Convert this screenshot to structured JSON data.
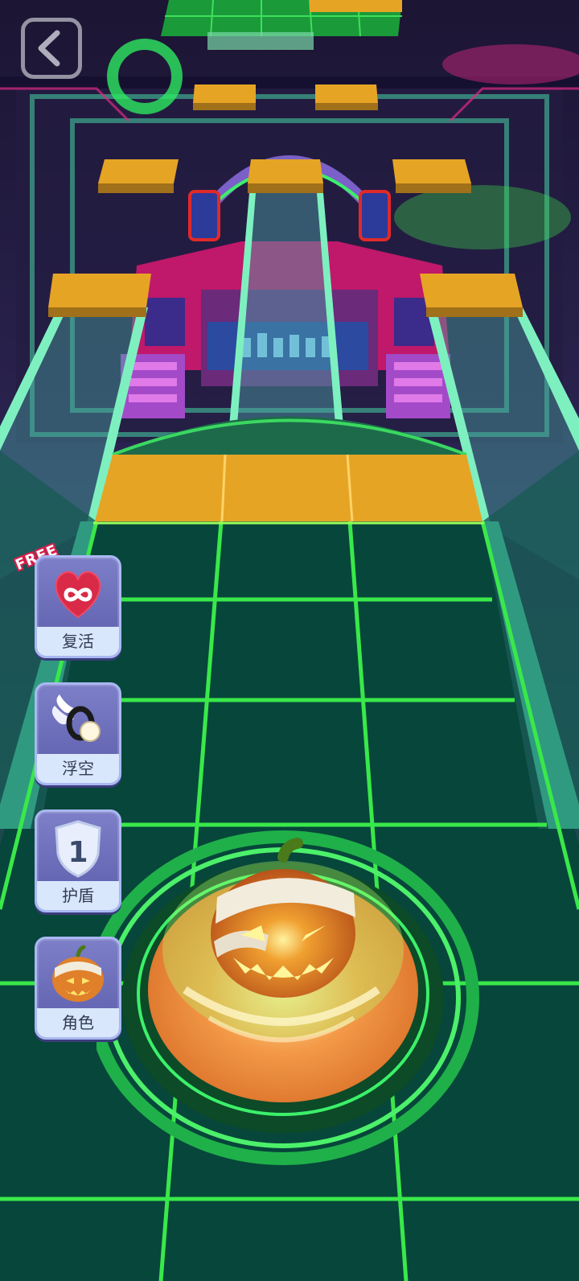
{
  "colors": {
    "floor": "#07463a",
    "grid": "#39e84a",
    "tile": "#e6a425",
    "neon_green": "#3cf06a",
    "neon_pink": "#e0207c",
    "panel": "#6a6bb8",
    "badge_red": "#d4204c"
  },
  "icons": {
    "back": "chevron-left-icon",
    "revive": "infinity-heart-icon",
    "float": "wing-ring-icon",
    "shield": "shield-icon",
    "character": "pumpkin-icon"
  },
  "hud": {
    "free_badge": "FREE"
  },
  "powerups": [
    {
      "id": "revive",
      "label": "复活"
    },
    {
      "id": "float",
      "label": "浮空"
    },
    {
      "id": "shield",
      "label": "护盾",
      "count": "1"
    },
    {
      "id": "character",
      "label": "角色"
    }
  ]
}
